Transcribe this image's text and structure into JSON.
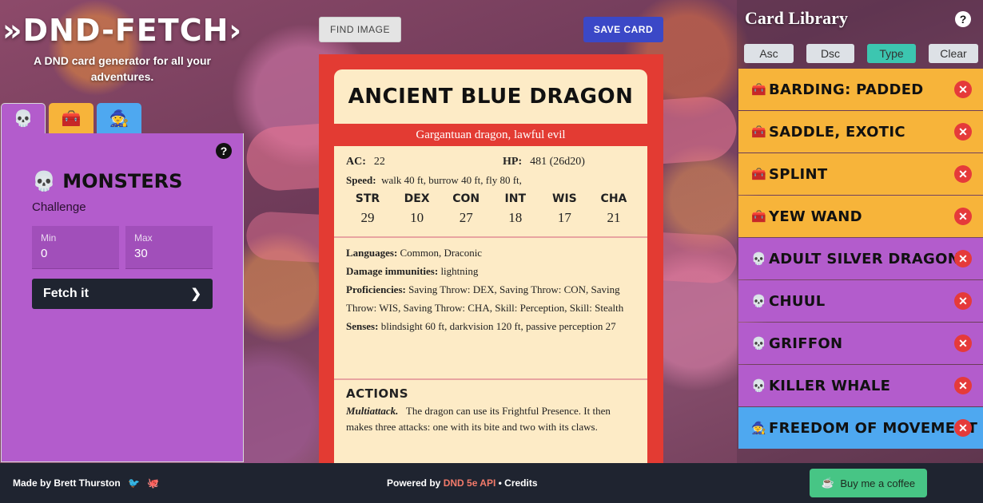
{
  "brand": {
    "logo": "»DND-FETCH›",
    "tagline": "A DND card generator for all your adventures."
  },
  "tabs": [
    {
      "name": "monsters",
      "icon": "skull-icon"
    },
    {
      "name": "equipment",
      "icon": "chest-icon"
    },
    {
      "name": "spells",
      "icon": "wizard-hat-icon"
    }
  ],
  "left_panel": {
    "title": "MONSTERS",
    "challenge_label": "Challenge",
    "min_label": "Min",
    "min_value": "0",
    "max_label": "Max",
    "max_value": "30",
    "fetch_label": "Fetch it"
  },
  "toolbar": {
    "find_image": "FIND IMAGE",
    "save_card": "SAVE CARD"
  },
  "card": {
    "name": "ANCIENT BLUE DRAGON",
    "type_line": "Gargantuan dragon, lawful evil",
    "ac_label": "AC:",
    "ac_value": "22",
    "hp_label": "HP:",
    "hp_value": "481 (26d20)",
    "speed_label": "Speed:",
    "speed_value": "walk 40 ft, burrow 40 ft, fly 80 ft,",
    "abilities": [
      {
        "key": "STR",
        "value": "29"
      },
      {
        "key": "DEX",
        "value": "10"
      },
      {
        "key": "CON",
        "value": "27"
      },
      {
        "key": "INT",
        "value": "18"
      },
      {
        "key": "WIS",
        "value": "17"
      },
      {
        "key": "CHA",
        "value": "21"
      }
    ],
    "languages_label": "Languages:",
    "languages_value": "Common, Draconic",
    "immunities_label": "Damage immunities:",
    "immunities_value": "lightning",
    "proficiencies_label": "Proficiencies:",
    "proficiencies_value": "Saving Throw: DEX, Saving Throw: CON, Saving Throw: WIS, Saving Throw: CHA, Skill: Perception, Skill: Stealth",
    "senses_label": "Senses:",
    "senses_value": "blindsight 60 ft, darkvision 120 ft, passive perception 27",
    "actions_heading": "ACTIONS",
    "action_name": "Multiattack.",
    "action_text": "The dragon can use its Frightful Presence. It then makes three attacks: one with its bite and two with its claws."
  },
  "library": {
    "title": "Card Library",
    "sort": [
      "Asc",
      "Dsc",
      "Type",
      "Clear"
    ],
    "active_sort": "Type",
    "items": [
      {
        "name": "BARDING: PADDED",
        "kind": "equipment",
        "icon": "chest-icon"
      },
      {
        "name": "SADDLE, EXOTIC",
        "kind": "equipment",
        "icon": "chest-icon"
      },
      {
        "name": "SPLINT",
        "kind": "equipment",
        "icon": "chest-icon"
      },
      {
        "name": "YEW WAND",
        "kind": "equipment",
        "icon": "chest-icon"
      },
      {
        "name": "ADULT SILVER DRAGON",
        "kind": "monster",
        "icon": "skull-icon"
      },
      {
        "name": "CHUUL",
        "kind": "monster",
        "icon": "skull-icon"
      },
      {
        "name": "GRIFFON",
        "kind": "monster",
        "icon": "skull-icon"
      },
      {
        "name": "KILLER WHALE",
        "kind": "monster",
        "icon": "skull-icon"
      },
      {
        "name": "FREEDOM OF MOVEMENT",
        "kind": "spell",
        "icon": "wizard-hat-icon"
      }
    ]
  },
  "footer": {
    "made_by": "Made by Brett Thurston",
    "powered_prefix": "Powered by",
    "api_name": "DND 5e API",
    "separator": "•",
    "credits": "Credits",
    "coffee": "Buy me a coffee"
  },
  "colors": {
    "monster": "#b35ccc",
    "equipment": "#f7b43a",
    "spell": "#4ea8f0",
    "card_red": "#e33b33",
    "parchment": "#fdebc6",
    "save_blue": "#3b48c7",
    "footer": "#1f2430",
    "coffee_green": "#47c585"
  }
}
